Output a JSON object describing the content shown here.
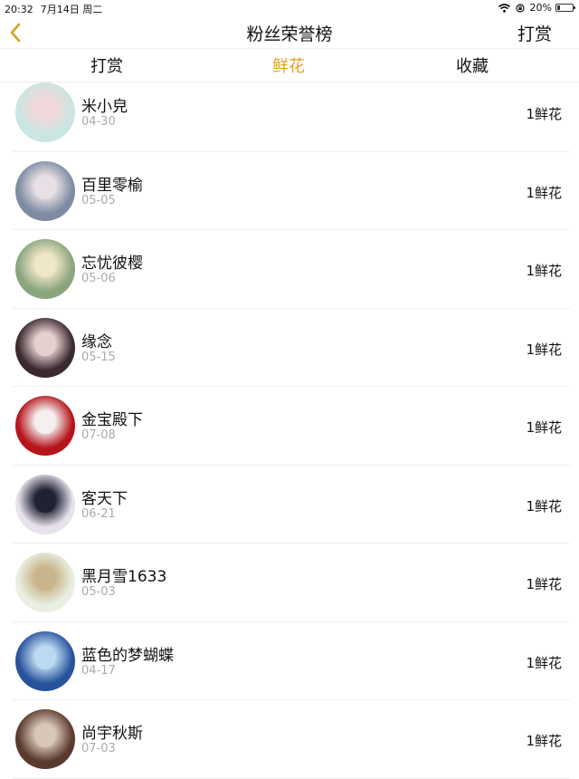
{
  "status_bar": {
    "time": "20:32",
    "date": "7月14日 周二",
    "battery": "20%",
    "battery_level": 0.2
  },
  "nav": {
    "title": "粉丝荣誉榜",
    "right_action": "打赏"
  },
  "tabs": [
    {
      "label": "打赏",
      "active": false
    },
    {
      "label": "鲜花",
      "active": true
    },
    {
      "label": "收藏",
      "active": false
    }
  ],
  "colors": {
    "accent": "#e6a020",
    "divider": "#eeeeee",
    "secondary_text": "#aaaaaa"
  },
  "fans": [
    {
      "name": "米小皃",
      "date": "04-30",
      "gift": "1鲜花",
      "avatar_colors": [
        "#c9e6e2",
        "#f2d8dc"
      ]
    },
    {
      "name": "百里零榆",
      "date": "05-05",
      "gift": "1鲜花",
      "avatar_colors": [
        "#7d8ca3",
        "#e8e0e4"
      ]
    },
    {
      "name": "忘忧彼樱",
      "date": "05-06",
      "gift": "1鲜花",
      "avatar_colors": [
        "#8aa57e",
        "#f1e6c8"
      ]
    },
    {
      "name": "缘念",
      "date": "05-15",
      "gift": "1鲜花",
      "avatar_colors": [
        "#3a2a30",
        "#e6cfcf"
      ]
    },
    {
      "name": "金宝殿下",
      "date": "07-08",
      "gift": "1鲜花",
      "avatar_colors": [
        "#b5141a",
        "#f4f0f0"
      ]
    },
    {
      "name": "客天下",
      "date": "06-21",
      "gift": "1鲜花",
      "avatar_colors": [
        "#e7e2ec",
        "#1f2233"
      ]
    },
    {
      "name": "黑月雪1633",
      "date": "05-03",
      "gift": "1鲜花",
      "avatar_colors": [
        "#e9efe2",
        "#c9b48b"
      ]
    },
    {
      "name": "蓝色的梦蝴蝶",
      "date": "04-17",
      "gift": "1鲜花",
      "avatar_colors": [
        "#27529b",
        "#bcd9f2"
      ]
    },
    {
      "name": "尚宇秋斯",
      "date": "07-03",
      "gift": "1鲜花",
      "avatar_colors": [
        "#5a3a2e",
        "#d8c6b8"
      ]
    }
  ]
}
